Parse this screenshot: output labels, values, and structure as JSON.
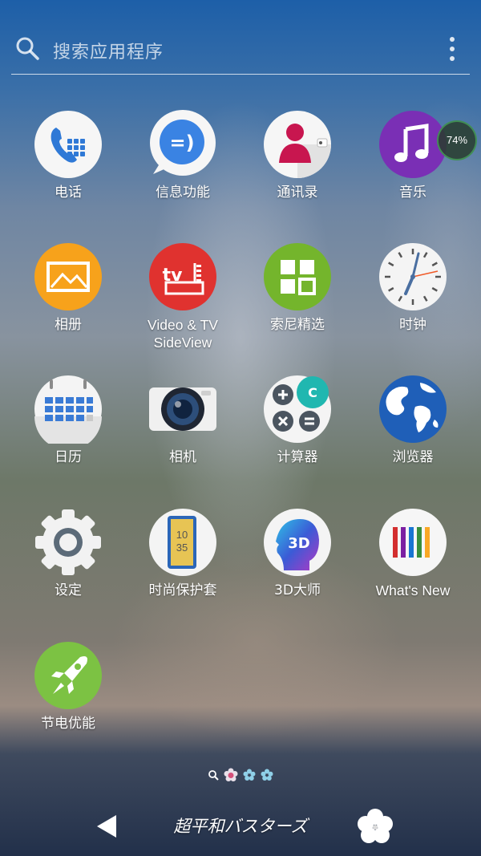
{
  "search": {
    "placeholder": "搜索应用程序"
  },
  "apps": [
    {
      "id": "phone",
      "label": "电话"
    },
    {
      "id": "messaging",
      "label": "信息功能"
    },
    {
      "id": "contacts",
      "label": "通讯录"
    },
    {
      "id": "music",
      "label": "音乐"
    },
    {
      "id": "album",
      "label": "相册"
    },
    {
      "id": "video-tv-sideview",
      "label": "Video & TV\nSideView"
    },
    {
      "id": "sony-select",
      "label": "索尼精选"
    },
    {
      "id": "clock",
      "label": "时钟"
    },
    {
      "id": "calendar",
      "label": "日历"
    },
    {
      "id": "camera",
      "label": "相机"
    },
    {
      "id": "calculator",
      "label": "计算器"
    },
    {
      "id": "browser",
      "label": "浏览器"
    },
    {
      "id": "settings",
      "label": "设定"
    },
    {
      "id": "xperia-themes",
      "label": "时尚保护套"
    },
    {
      "id": "3d-creator",
      "label": "3D大师"
    },
    {
      "id": "whats-new",
      "label": "What's New"
    },
    {
      "id": "stamina",
      "label": "节电优能"
    }
  ],
  "battery_widget": {
    "percent": "74%"
  },
  "bottom_bar": {
    "center_text": "超平和バスターズ"
  },
  "icons": {
    "search": "search-icon",
    "menu": "overflow-menu-icon",
    "back": "back-triangle-icon",
    "flower": "flower-icon"
  },
  "colors": {
    "phone": "#2f79d6",
    "messaging": "#3a83e3",
    "contacts": "#c8164f",
    "music": "#7a2fb5",
    "album": "#f7a21b",
    "video": "#e0322f",
    "sony_select": "#74b52c",
    "browser": "#1f5fb8",
    "stamina": "#7cc243"
  }
}
